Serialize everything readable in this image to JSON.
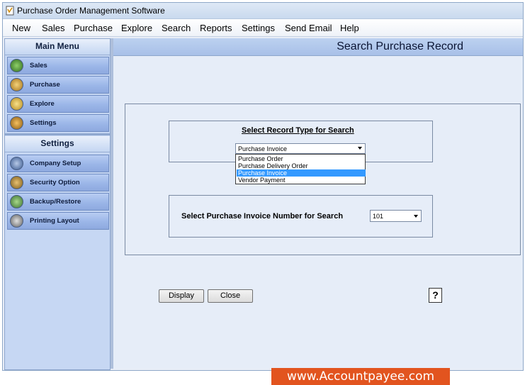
{
  "app": {
    "title": "Purchase Order Management Software"
  },
  "menubar": [
    "New",
    "Sales",
    "Purchase",
    "Explore",
    "Search",
    "Reports",
    "Settings",
    "Send Email",
    "Help"
  ],
  "sidebar": {
    "main_menu_title": "Main Menu",
    "main_items": [
      {
        "label": "Sales",
        "icon": "sales-chart-icon"
      },
      {
        "label": "Purchase",
        "icon": "purchase-box-icon"
      },
      {
        "label": "Explore",
        "icon": "explore-folder-icon"
      },
      {
        "label": "Settings",
        "icon": "settings-gear-icon"
      }
    ],
    "settings_title": "Settings",
    "settings_items": [
      {
        "label": "Company Setup",
        "icon": "company-setup-icon"
      },
      {
        "label": "Security Option",
        "icon": "lock-icon"
      },
      {
        "label": "Backup/Restore",
        "icon": "backup-restore-icon"
      },
      {
        "label": "Printing Layout",
        "icon": "printer-icon"
      }
    ]
  },
  "page": {
    "title": "Search Purchase Record",
    "record_type_label": "Select Record Type for Search",
    "record_type_selected": "Purchase Invoice",
    "record_type_options": [
      "Purchase Order",
      "Purchase Delivery Order",
      "Purchase Invoice",
      "Vendor Payment"
    ],
    "record_type_highlighted": "Purchase Invoice",
    "invoice_number_label": "Select Purchase Invoice Number for Search",
    "invoice_number_value": "101",
    "display_button": "Display",
    "close_button": "Close",
    "help_button": "?"
  },
  "footer": {
    "brand": "www.Accountpayee.com"
  },
  "colors": {
    "brand": "#e2541f",
    "selection": "#3399ff",
    "sidebar": "#c6d7f3"
  }
}
